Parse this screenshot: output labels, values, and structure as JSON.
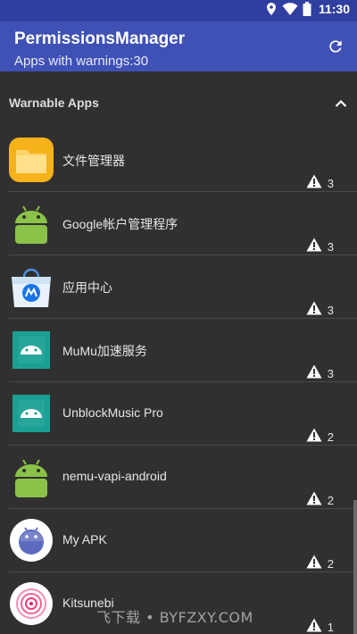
{
  "status_bar": {
    "time": "11:30",
    "icons": [
      "location-icon",
      "wifi-icon",
      "battery-icon"
    ]
  },
  "app_bar": {
    "title": "PermissionsManager",
    "subtitle": "Apps with warnings:30",
    "background": "#3f51b5",
    "status_color": "#303f9f"
  },
  "section": {
    "title": "Warnable Apps"
  },
  "apps": [
    {
      "name": "文件管理器",
      "warnings": "3",
      "icon": "folder-app-icon"
    },
    {
      "name": "Google帐户管理程序",
      "warnings": "3",
      "icon": "android-app-icon"
    },
    {
      "name": "应用中心",
      "warnings": "3",
      "icon": "app-center-icon"
    },
    {
      "name": "MuMu加速服务",
      "warnings": "3",
      "icon": "teal-android-icon"
    },
    {
      "name": "UnblockMusic Pro",
      "warnings": "2",
      "icon": "teal-android-icon"
    },
    {
      "name": "nemu-vapi-android",
      "warnings": "2",
      "icon": "android-app-icon"
    },
    {
      "name": "My APK",
      "warnings": "2",
      "icon": "round-android-icon"
    },
    {
      "name": "Kitsunebi",
      "warnings": "1",
      "icon": "kitsunebi-icon"
    }
  ],
  "watermark": "飞下载 • BYFZXY.COM"
}
